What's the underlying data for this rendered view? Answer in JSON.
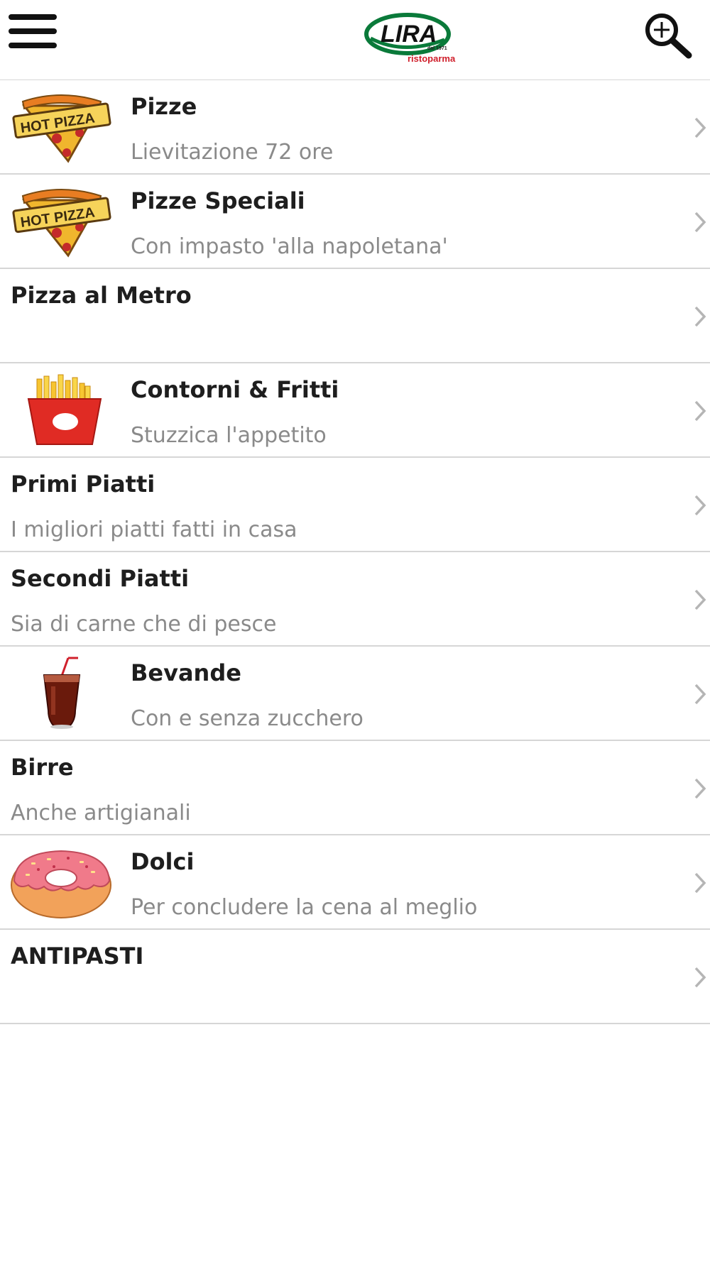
{
  "header": {
    "logo_text": "LIRA",
    "logo_since": "dal 1971",
    "logo_sub": "ristoparma",
    "menu_icon": "hamburger-menu-icon",
    "search_icon": "zoom-in-search-icon"
  },
  "categories": [
    {
      "title": "Pizze",
      "subtitle": "Lievitazione 72 ore",
      "image": "hot-pizza-slice",
      "image_text": "HOT PIZZA"
    },
    {
      "title": "Pizze Speciali",
      "subtitle": "Con impasto 'alla napoletana'",
      "image": "hot-pizza-slice",
      "image_text": "HOT PIZZA"
    },
    {
      "title": "Pizza al Metro",
      "subtitle": "",
      "image": ""
    },
    {
      "title": "Contorni & Fritti",
      "subtitle": "Stuzzica l'appetito",
      "image": "french-fries"
    },
    {
      "title": "Primi Piatti",
      "subtitle": "I migliori piatti fatti in casa",
      "image": ""
    },
    {
      "title": "Secondi Piatti",
      "subtitle": "Sia di carne che di pesce",
      "image": ""
    },
    {
      "title": "Bevande",
      "subtitle": "Con e senza zucchero",
      "image": "cola-glass"
    },
    {
      "title": "Birre",
      "subtitle": "Anche artigianali",
      "image": ""
    },
    {
      "title": "Dolci",
      "subtitle": "Per concludere la cena al meglio",
      "image": "donut"
    },
    {
      "title": "ANTIPASTI",
      "subtitle": "",
      "image": ""
    }
  ],
  "colors": {
    "divider": "#d6d6d6",
    "title": "#1e1e1e",
    "subtitle": "#8a8a8a",
    "chevron": "#b5b5b5",
    "logo_green": "#0a7a3a",
    "logo_red": "#d0202c"
  }
}
